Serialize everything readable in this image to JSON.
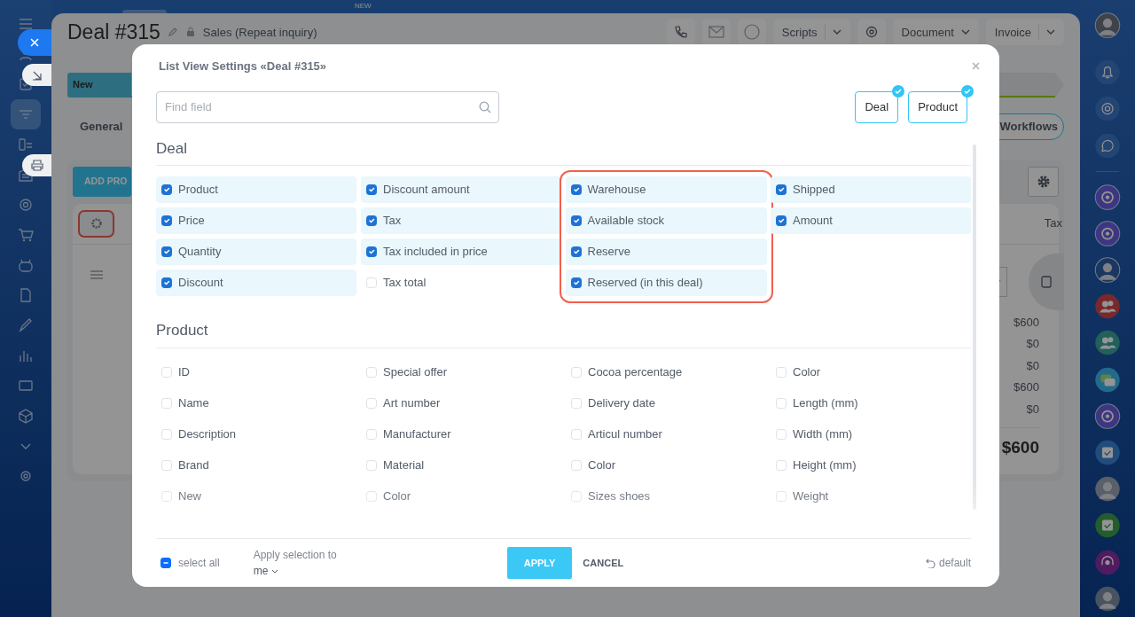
{
  "deal": {
    "top_badge": "NEW",
    "title": "Deal #315",
    "pipeline": "Sales (Repeat inquiry)",
    "toolbar": [
      {
        "label": "Scripts",
        "kind": "split"
      },
      {
        "label": "Document",
        "kind": "dropdown"
      },
      {
        "label": "Invoice",
        "kind": "split"
      }
    ],
    "stage": "New",
    "tab": "General",
    "workflows_button": "Workflows",
    "add_button": "ADD PRO",
    "settings_highlighted": true,
    "column_header": "Tax",
    "amounts": [
      "$600",
      "$0",
      "$0",
      "$600",
      "$0"
    ],
    "total": "$600"
  },
  "modal": {
    "title": "List View Settings «Deal #315»",
    "search": {
      "placeholder": "Find field"
    },
    "filters": [
      {
        "label": "Deal",
        "checked": true
      },
      {
        "label": "Product",
        "checked": true
      }
    ],
    "sections": [
      {
        "title": "Deal",
        "columns": [
          {
            "highlighted": false,
            "fields": [
              {
                "label": "Product",
                "checked": true
              },
              {
                "label": "Price",
                "checked": true
              },
              {
                "label": "Quantity",
                "checked": true
              },
              {
                "label": "Discount",
                "checked": true
              }
            ]
          },
          {
            "highlighted": false,
            "fields": [
              {
                "label": "Discount amount",
                "checked": true
              },
              {
                "label": "Tax",
                "checked": true
              },
              {
                "label": "Tax included in price",
                "checked": true
              },
              {
                "label": "Tax total",
                "checked": false
              }
            ]
          },
          {
            "highlighted": true,
            "fields": [
              {
                "label": "Warehouse",
                "checked": true
              },
              {
                "label": "Available stock",
                "checked": true
              },
              {
                "label": "Reserve",
                "checked": true
              },
              {
                "label": "Reserved (in this deal)",
                "checked": true
              }
            ]
          },
          {
            "highlighted": false,
            "fields": [
              {
                "label": "Shipped",
                "checked": true
              },
              {
                "label": "Amount",
                "checked": true
              }
            ]
          }
        ]
      },
      {
        "title": "Product",
        "columns": [
          {
            "highlighted": false,
            "fields": [
              {
                "label": "ID",
                "checked": false
              },
              {
                "label": "Name",
                "checked": false
              },
              {
                "label": "Description",
                "checked": false
              },
              {
                "label": "Brand",
                "checked": false
              },
              {
                "label": "New",
                "checked": false
              }
            ]
          },
          {
            "highlighted": false,
            "fields": [
              {
                "label": "Special offer",
                "checked": false
              },
              {
                "label": "Art number",
                "checked": false
              },
              {
                "label": "Manufacturer",
                "checked": false
              },
              {
                "label": "Material",
                "checked": false
              },
              {
                "label": "Color",
                "checked": false
              }
            ]
          },
          {
            "highlighted": false,
            "fields": [
              {
                "label": "Cocoa percentage",
                "checked": false
              },
              {
                "label": "Delivery date",
                "checked": false
              },
              {
                "label": "Articul number",
                "checked": false
              },
              {
                "label": "Color",
                "checked": false
              },
              {
                "label": "Sizes shoes",
                "checked": false
              }
            ]
          },
          {
            "highlighted": false,
            "fields": [
              {
                "label": "Color",
                "checked": false
              },
              {
                "label": "Length (mm)",
                "checked": false
              },
              {
                "label": "Width (mm)",
                "checked": false
              },
              {
                "label": "Height (mm)",
                "checked": false
              },
              {
                "label": "Weight",
                "checked": false
              }
            ]
          }
        ]
      }
    ],
    "footer": {
      "select_all": {
        "label": "select all",
        "indeterminate": true
      },
      "apply_to": {
        "label": "Apply selection to",
        "value": "me"
      },
      "apply": "APPLY",
      "cancel": "CANCEL",
      "reset": "default"
    }
  }
}
